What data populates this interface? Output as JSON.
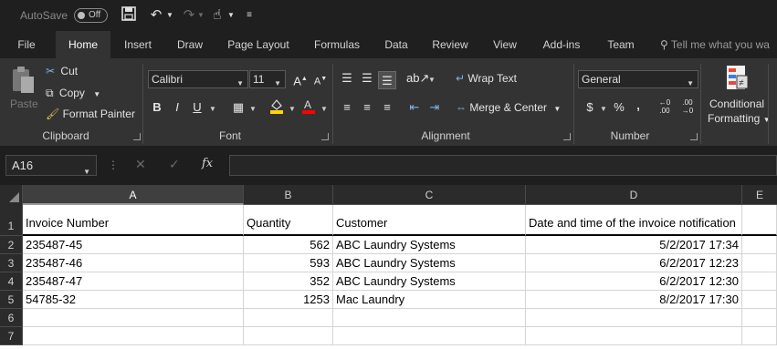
{
  "title_bar": {
    "autosave_label": "AutoSave",
    "autosave_toggle": "Off"
  },
  "tabs": [
    "File",
    "Home",
    "Insert",
    "Draw",
    "Page Layout",
    "Formulas",
    "Data",
    "Review",
    "View",
    "Add-ins",
    "Team"
  ],
  "active_tab": "Home",
  "tell_me_placeholder": "Tell me what you wa",
  "ribbon": {
    "clipboard": {
      "label": "Clipboard",
      "paste": "Paste",
      "cut": "Cut",
      "copy": "Copy",
      "format_painter": "Format Painter"
    },
    "font": {
      "label": "Font",
      "font_name": "Calibri",
      "font_size": "11",
      "bold": "B",
      "italic": "I",
      "underline": "U"
    },
    "alignment": {
      "label": "Alignment",
      "wrap_text": "Wrap Text",
      "merge_center": "Merge & Center"
    },
    "number": {
      "label": "Number",
      "format": "General",
      "currency": "$",
      "percent": "%",
      "comma": ","
    },
    "styles": {
      "conditional_formatting_line1": "Conditional",
      "conditional_formatting_line2": "Formatting"
    }
  },
  "formula_bar": {
    "name_box": "A16",
    "fx": "fx"
  },
  "columns": [
    "A",
    "B",
    "C",
    "D",
    "E"
  ],
  "selected_column": "A",
  "rows": [
    {
      "n": "1",
      "cells": [
        "Invoice Number",
        "Quantity",
        "Customer",
        "Date and time of the invoice notification"
      ]
    },
    {
      "n": "2",
      "cells": [
        "235487-45",
        "562",
        "ABC Laundry Systems",
        "5/2/2017 17:34"
      ]
    },
    {
      "n": "3",
      "cells": [
        "235487-46",
        "593",
        "ABC Laundry Systems",
        "6/2/2017 12:23"
      ]
    },
    {
      "n": "4",
      "cells": [
        "235487-47",
        "352",
        "ABC Laundry Systems",
        "6/2/2017 12:30"
      ]
    },
    {
      "n": "5",
      "cells": [
        "54785-32",
        "1253",
        "Mac Laundry",
        "8/2/2017 17:30"
      ]
    },
    {
      "n": "6",
      "cells": [
        "",
        "",
        "",
        ""
      ]
    },
    {
      "n": "7",
      "cells": [
        "",
        "",
        "",
        ""
      ]
    }
  ],
  "colors": {
    "accent_fill": "#ffd700",
    "accent_font": "#ff0000",
    "header_bg": "#2b2b2b",
    "ribbon_bg": "#333333"
  }
}
